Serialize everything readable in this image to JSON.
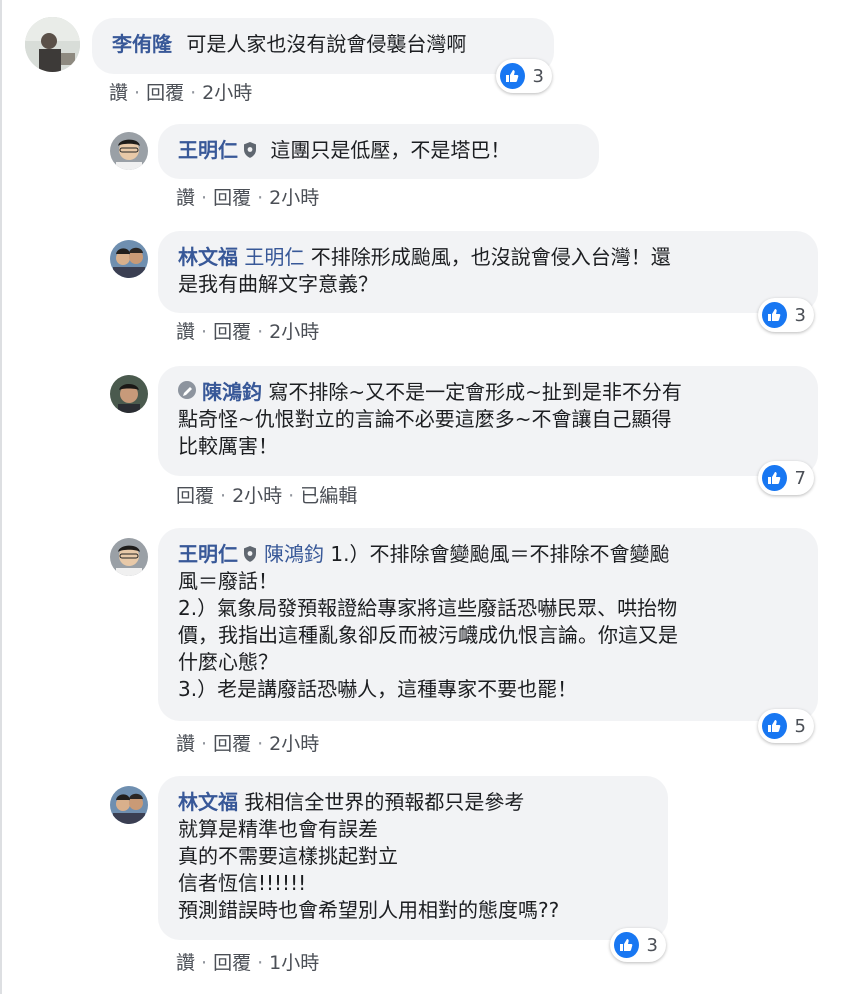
{
  "comments": [
    {
      "author": "李侑隆",
      "text": "可是人家也沒有說會侵襲台灣啊",
      "like": "讚",
      "reply": "回覆",
      "time": "2小時",
      "reactions": "3"
    },
    {
      "author": "王明仁",
      "text": "這團只是低壓，不是塔巴！",
      "like": "讚",
      "reply": "回覆",
      "time": "2小時"
    },
    {
      "author": "林文福",
      "mention": "王明仁",
      "text1": "不排除形成颱風，也沒說會侵入台灣！還",
      "text2": "是我有曲解文字意義？",
      "like": "讚",
      "reply": "回覆",
      "time": "2小時",
      "reactions": "3"
    },
    {
      "author": "陳鴻鈞",
      "text1": "寫不排除~又不是一定會形成~扯到是非不分有",
      "text2": "點奇怪~仇恨對立的言論不必要這麼多~不會讓自己顯得",
      "text3": "比較厲害！",
      "reply": "回覆",
      "time": "2小時",
      "edited": "已編輯",
      "reactions": "7"
    },
    {
      "author": "王明仁",
      "mention": "陳鴻鈞",
      "text1": "1.）不排除會變颱風＝不排除不會變颱",
      "text2": "風＝廢話！",
      "text3": "2.）氣象局發預報證給專家將這些廢話恐嚇民眾、哄抬物",
      "text4": "價，我指出這種亂象卻反而被污衊成仇恨言論。你這又是",
      "text5": "什麼心態？",
      "text6": "3.）老是講廢話恐嚇人，這種專家不要也罷！",
      "like": "讚",
      "reply": "回覆",
      "time": "2小時",
      "reactions": "5"
    },
    {
      "author": "林文福",
      "text1": "我相信全世界的預報都只是參考",
      "text2": "就算是精準也會有誤差",
      "text3": "真的不需要這樣挑起對立",
      "text4": "信者恆信!!!!!!",
      "text5": "預測錯誤時也會希望別人用相對的態度嗎??",
      "like": "讚",
      "reply": "回覆",
      "time": "1小時",
      "reactions": "3"
    }
  ],
  "colors": {
    "link": "#385898",
    "bubble": "#f2f3f5",
    "like": "#1877f2"
  },
  "icons": [
    "like-icon",
    "shield-icon",
    "edited-icon"
  ]
}
